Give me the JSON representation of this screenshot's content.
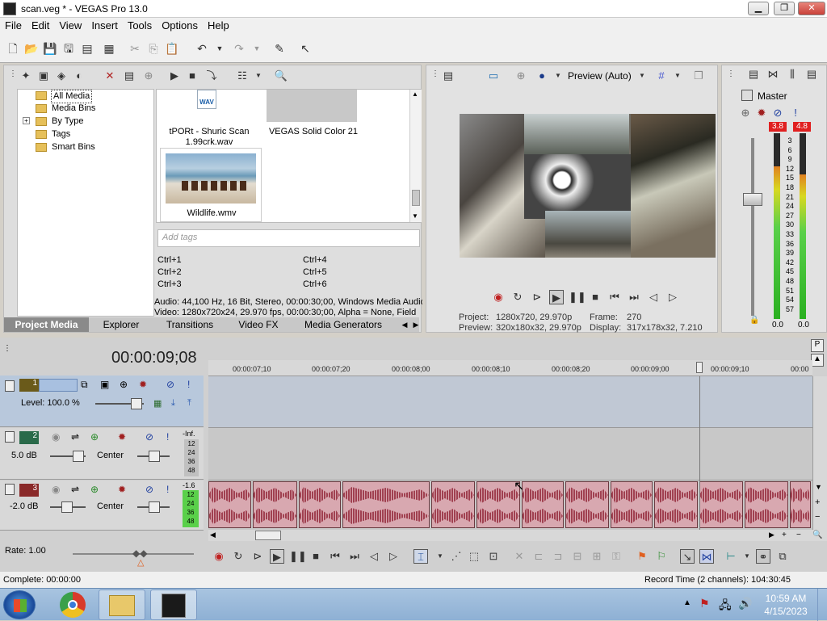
{
  "window": {
    "title": "scan.veg * - VEGAS Pro 13.0",
    "minimize": "▁",
    "maximize": "❐",
    "close": "✕"
  },
  "menu": [
    "File",
    "Edit",
    "View",
    "Insert",
    "Tools",
    "Options",
    "Help"
  ],
  "project_media": {
    "tree": [
      {
        "label": "All Media",
        "selected": true
      },
      {
        "label": "Media Bins"
      },
      {
        "label": "By Type",
        "expandable": true,
        "expand_glyph": "+"
      },
      {
        "label": "Tags"
      },
      {
        "label": "Smart Bins"
      }
    ],
    "media_items": [
      {
        "label": "tPORt - Shuric Scan 1.99crk.wav",
        "badge": "WAV"
      },
      {
        "label": "VEGAS Solid Color 21"
      },
      {
        "label": "Wildlife.wmv"
      }
    ],
    "tags_placeholder": "Add tags",
    "shortcuts": [
      "Ctrl+1",
      "Ctrl+2",
      "Ctrl+3",
      "Ctrl+4",
      "Ctrl+5",
      "Ctrl+6"
    ],
    "audio_info": "Audio: 44,100 Hz, 16 Bit, Stereo, 00:00:30;00, Windows Media Audio",
    "video_info": "Video: 1280x720x24, 29.970 fps, 00:00:30;00, Alpha = None, Field",
    "tabs": [
      "Project Media",
      "Explorer",
      "Transitions",
      "Video FX",
      "Media Generators"
    ]
  },
  "preview": {
    "mode": "Preview (Auto)",
    "project_label": "Project:",
    "project_value": "1280x720, 29.970p",
    "preview_label": "Preview:",
    "preview_value": "320x180x32, 29.970p",
    "frame_label": "Frame:",
    "frame_value": "270",
    "display_label": "Display:",
    "display_value": "317x178x32, 7.210"
  },
  "master": {
    "title": "Master",
    "peak_left": "3.8",
    "peak_right": "4.8",
    "scale": [
      "3",
      "6",
      "9",
      "12",
      "15",
      "18",
      "21",
      "24",
      "27",
      "30",
      "33",
      "36",
      "39",
      "42",
      "45",
      "48",
      "51",
      "54",
      "57"
    ],
    "out_left": "0.0",
    "out_right": "0.0",
    "level_left": 0.82,
    "level_right": 0.78
  },
  "timeline": {
    "current_time": "00:00:09;08",
    "ruler": [
      "00:00:07;10",
      "00:00:07;20",
      "00:00:08;00",
      "00:00:08;10",
      "00:00:08;20",
      "00:00:09;00",
      "00:00:09;10",
      "00:00"
    ],
    "tracks": [
      {
        "number": "1",
        "type": "video",
        "level": "Level: 100.0 %"
      },
      {
        "number": "2",
        "type": "audio",
        "volume": "5.0 dB",
        "pan": "Center",
        "meter_top": "-Inf.",
        "meter_scale": [
          "12",
          "24",
          "36",
          "48"
        ]
      },
      {
        "number": "3",
        "type": "audio",
        "volume": "-2.0 dB",
        "pan": "Center",
        "meter_top": "-1.6",
        "meter_scale": [
          "12",
          "24",
          "36",
          "48"
        ]
      }
    ],
    "rate": "Rate: 1.00"
  },
  "status": {
    "left": "Complete: 00:00:00",
    "right": "Record Time (2 channels): 104:30:45"
  },
  "taskbar": {
    "time": "10:59 AM",
    "date": "4/15/2023"
  },
  "colors": {
    "accent": "#3a78c8",
    "waveform": "#a04050",
    "clip": "#d8a8b0",
    "meter_peak": "#e02020"
  }
}
